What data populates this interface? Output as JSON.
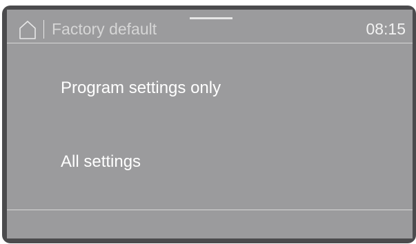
{
  "header": {
    "title": "Factory default",
    "time": "08:15",
    "home_icon": "home-icon"
  },
  "menu": {
    "items": [
      {
        "label": "Program settings only"
      },
      {
        "label": "All settings"
      }
    ]
  },
  "colors": {
    "bezel": "#4b4b4d",
    "screen": "#9b9b9d",
    "text": "#ffffff",
    "title_text": "#d6d6d6",
    "divider": "#d8d8d8"
  }
}
